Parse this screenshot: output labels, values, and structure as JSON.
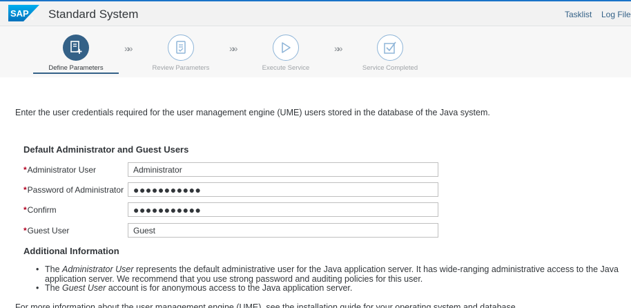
{
  "header": {
    "title": "Standard System",
    "links": [
      "Tasklist",
      "Log Files"
    ]
  },
  "wizard": {
    "steps": [
      {
        "label": "Define Parameters",
        "icon": "edit-document-icon",
        "state": "active"
      },
      {
        "label": "Review Parameters",
        "icon": "review-document-icon",
        "state": "inactive"
      },
      {
        "label": "Execute Service",
        "icon": "play-icon",
        "state": "inactive"
      },
      {
        "label": "Service Completed",
        "icon": "checkbox-checked-icon",
        "state": "inactive"
      }
    ],
    "separator": "»»"
  },
  "intro": "Enter the user credentials required for the user management engine (UME) users stored in the database of the Java system.",
  "form": {
    "section_title": "Default Administrator and Guest Users",
    "required_marker": "*",
    "fields": [
      {
        "label": "Administrator User",
        "value": "Administrator"
      },
      {
        "label": "Password of Administrator",
        "value": "●●●●●●●●●●●"
      },
      {
        "label": "Confirm",
        "value": "●●●●●●●●●●●"
      },
      {
        "label": "Guest User",
        "value": "Guest"
      }
    ]
  },
  "info": {
    "title": "Additional Information",
    "items": [
      {
        "pre": "The ",
        "em": "Administrator User",
        "post": " represents the default administrative user for the Java application server. It has wide-ranging administrative access to the Java application server. We recommend that you use strong password and auditing policies for this user."
      },
      {
        "pre": "The ",
        "em": "Guest User",
        "post": " account is for anonymous access to the Java application server."
      }
    ],
    "bullet": "•",
    "trailing": "For more information about the user management engine (UME), see the installation guide for your operating system and database."
  },
  "colors": {
    "accent": "#346187",
    "topbar_border": "#1a73c8",
    "required": "#b00020"
  }
}
